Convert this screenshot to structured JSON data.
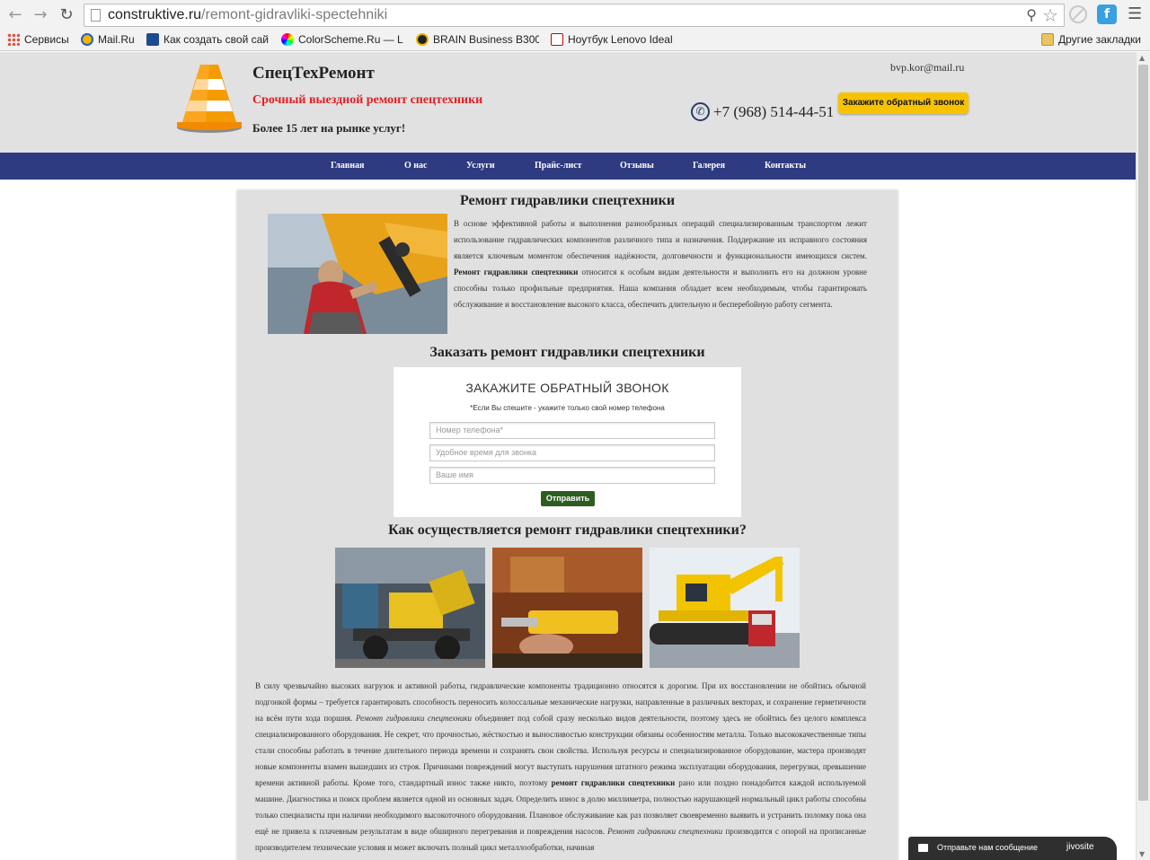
{
  "browser": {
    "url_domain": "construktive.ru",
    "url_path": "/remont-gidravliki-spectehniki",
    "bookmarks": [
      {
        "label": "Сервисы",
        "icon": "apps-grid-icon"
      },
      {
        "label": "Mail.Ru",
        "icon": "mailru-icon"
      },
      {
        "label": "Как создать свой сай",
        "icon": "site-icon"
      },
      {
        "label": "ColorScheme.Ru — L",
        "icon": "color-wheel-icon"
      },
      {
        "label": "BRAIN Business B300",
        "icon": "brain-icon"
      },
      {
        "label": "Ноутбук Lenovo Ideal",
        "icon": "lenovo-icon"
      }
    ],
    "other_bookmarks": "Другие закладки"
  },
  "header": {
    "brand": "СпецТехРемонт",
    "tagline": "Срочный выездной ремонт спецтехники",
    "years": "Более 15 лет на рынке услуг!",
    "email": "bvp.kor@mail.ru",
    "phone": "+7 (968) 514-44-51",
    "callback_button": "Закажите обратный звонок"
  },
  "nav": {
    "items": [
      "Главная",
      "О нас",
      "Услуги",
      "Прайс-лист",
      "Отзывы",
      "Галерея",
      "Контакты"
    ]
  },
  "content": {
    "title": "Ремонт гидравлики спецтехники",
    "intro_1": "В основе эффективной работы и выполнения разнообразных операций специализированным транспортом лежит использование гидравлических компонентов различного типа и назначения. Поддержание их исправного состояния является ключевым моментом обеспечения надёжности, долговечности и функциональности имеющихся систем. ",
    "intro_bold": "Ремонт гидравлики спецтехники",
    "intro_2": " относится к особым видам деятельности и выполнить его на должном уровне способны только профильные предприятия. Наша компания обладает всем необходимым, чтобы гарантировать обслуживание и восстановление высокого класса, обеспечить длительную и бесперебойную работу сегмента.",
    "order_title": "Заказать ремонт гидравлики спецтехники",
    "form": {
      "title": "ЗАКАЖИТЕ ОБРАТНЫЙ ЗВОНОК",
      "note": "*Если Вы спешите - укажите только свой номер телефона",
      "phone_placeholder": "Номер телефона*",
      "time_placeholder": "Удобное время для звонка",
      "name_placeholder": "Ваше имя",
      "submit": "Отправить"
    },
    "how_title": "Как осуществляется ремонт гидравлики спецтехники?",
    "body_1": "В силу чрезвычайно высоких нагрузок и активной работы, гидравлические компоненты традиционно относятся к дорогим. При их восстановлении не обойтись обычной подгонкой формы – требуется гарантировать способность переносить колоссальные механические нагрузки, направленные в различных векторах, и сохранение герметичности на всём пути хода поршня. ",
    "body_italic_1": "Ремонт гидравлики спецтехники",
    "body_2": " объединяет под собой сразу несколько видов деятельности, поэтому здесь не обойтись без целого комплекса специализированного оборудования. Не секрет, что прочностью, жёсткостью и выносливостью конструкции обязаны особенностям металла. Только высококачественные типы стали способны работать в течение длительного периода времени и сохранять свои свойства. Используя ресурсы и специализированное оборудование, мастера производят новые компоненты взамен вышедших из строя. Причинами повреждений могут выступать нарушения штатного режима эксплуатации оборудования, перегрузки, превышение времени активной работы. Кроме того, стандартный износ также никто, поэтому ",
    "body_bold": "ремонт гидравлики спецтехники",
    "body_3": " рано или поздно понадобится каждой используемой машине. Диагностика и поиск проблем является одной из основных задач. Определить износ в долю миллиметра, полностью нарушающей нормальный цикл работы способны только специалисты при наличии необходимого высокоточного оборудования. Плановое обслуживание как раз позволяет своевременно выявить и устранить поломку пока она ещё не привела к плачевным результатам в виде обширного перегревания и повреждения насосов. ",
    "body_italic_2": "Ремонт гидравлики спецтехники",
    "body_4": " производится с опорой на прописанные производителем технические условия и может включать полный цикл металлообработки, начиная"
  },
  "chat": {
    "label": "Отправьте нам сообщение",
    "brand": "jivosite"
  },
  "colors": {
    "header_bg": "#e1e1e1",
    "nav_bg": "#2e3b80",
    "tagline": "#e31e24",
    "callback_btn": "#f7c300",
    "submit_btn": "#2f5d20"
  }
}
